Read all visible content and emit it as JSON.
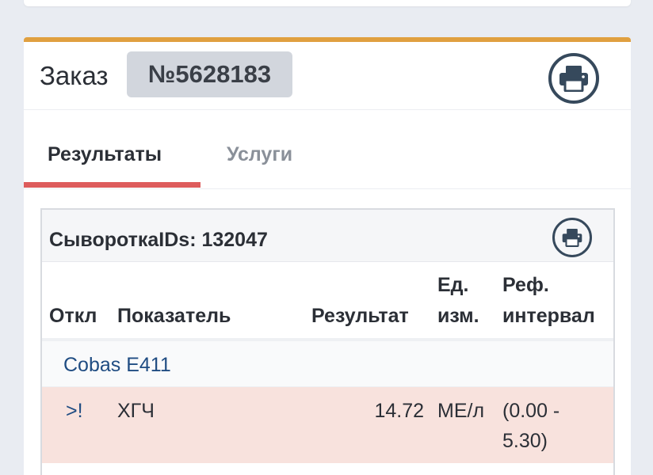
{
  "order": {
    "label": "Заказ",
    "number": "№5628183"
  },
  "tabs": [
    {
      "label": "Результаты",
      "active": true
    },
    {
      "label": "Услуги",
      "active": false
    }
  ],
  "sample": {
    "title": "СывороткаIDs: 132047"
  },
  "table": {
    "headers": {
      "flag": "Откл",
      "indicator": "Показатель",
      "result": "Результат",
      "unit_line1": "Ед.",
      "unit_line2": "изм.",
      "ref_line1": "Реф.",
      "ref_line2": "интервал"
    },
    "group": "Cobas E411",
    "rows": [
      {
        "flag": ">!",
        "indicator": "ХГЧ",
        "result": "14.72",
        "unit": "МЕ/л",
        "ref_line1": "(0.00 -",
        "ref_line2": "5.30)"
      }
    ]
  },
  "colors": {
    "accent_top": "#e0a040",
    "tab_underline": "#dd5c5c",
    "abnormal_row": "#f8e2dd",
    "link": "#1f4c82"
  },
  "icons": {
    "order_print": "printer-icon",
    "sample_print": "printer-icon"
  }
}
